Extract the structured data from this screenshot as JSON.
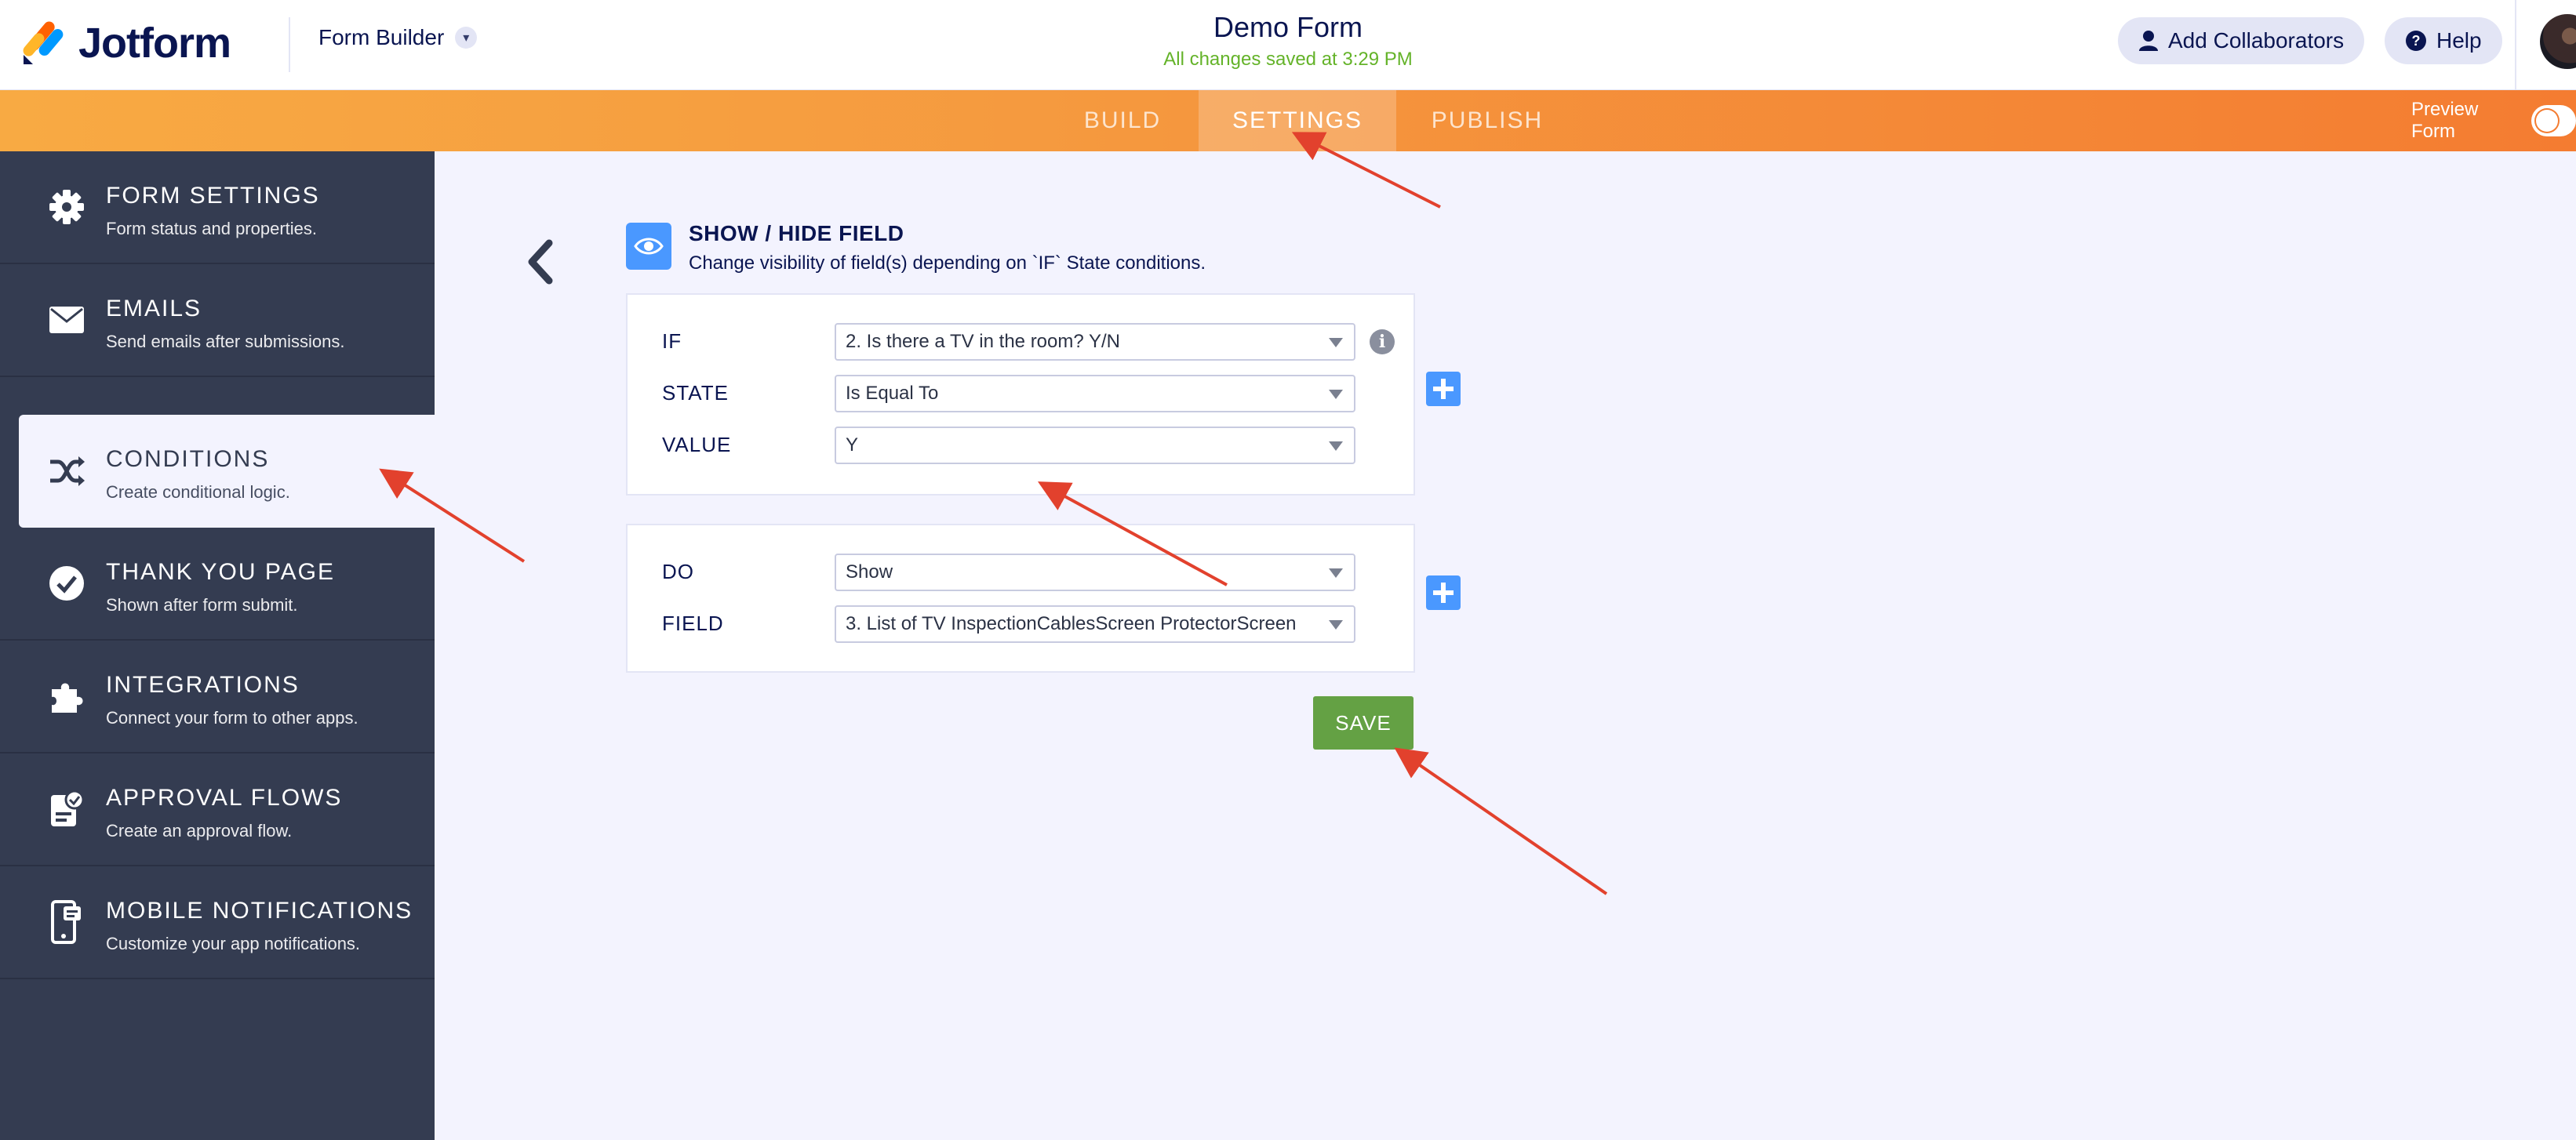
{
  "header": {
    "logo_text": "Jotform",
    "form_builder_label": "Form Builder",
    "form_title": "Demo Form",
    "save_status": "All changes saved at 3:29 PM",
    "add_collaborators_label": "Add Collaborators",
    "help_label": "Help"
  },
  "nav": {
    "tabs": [
      {
        "label": "BUILD",
        "active": false
      },
      {
        "label": "SETTINGS",
        "active": true
      },
      {
        "label": "PUBLISH",
        "active": false
      }
    ],
    "preview_label": "Preview Form"
  },
  "sidebar": {
    "items": [
      {
        "title": "FORM SETTINGS",
        "subtitle": "Form status and properties.",
        "icon": "gear-icon",
        "active": false
      },
      {
        "title": "EMAILS",
        "subtitle": "Send emails after submissions.",
        "icon": "envelope-icon",
        "active": false
      },
      {
        "title": "CONDITIONS",
        "subtitle": "Create conditional logic.",
        "icon": "shuffle-icon",
        "active": true
      },
      {
        "title": "THANK YOU PAGE",
        "subtitle": "Shown after form submit.",
        "icon": "check-circle-icon",
        "active": false
      },
      {
        "title": "INTEGRATIONS",
        "subtitle": "Connect your form to other apps.",
        "icon": "puzzle-icon",
        "active": false
      },
      {
        "title": "APPROVAL FLOWS",
        "subtitle": "Create an approval flow.",
        "icon": "approval-icon",
        "active": false
      },
      {
        "title": "MOBILE NOTIFICATIONS",
        "subtitle": "Customize your app notifications.",
        "icon": "mobile-icon",
        "active": false
      }
    ]
  },
  "condition": {
    "title": "SHOW / HIDE FIELD",
    "description": "Change visibility of field(s) depending on `IF` State conditions.",
    "if_label": "IF",
    "if_value": "2. Is there a TV in the room? Y/N",
    "state_label": "STATE",
    "state_value": "Is Equal To",
    "value_label": "VALUE",
    "value_value": "Y",
    "do_label": "DO",
    "do_value": "Show",
    "field_label": "FIELD",
    "field_value": "3. List of TV InspectionCablesScreen ProtectorScreen",
    "save_label": "SAVE"
  },
  "colors": {
    "accent_orange": "#f47c31",
    "sidebar_bg": "#343c51",
    "primary_blue": "#4a98ff",
    "save_green": "#64a144",
    "annotation_red": "#e2412d"
  }
}
